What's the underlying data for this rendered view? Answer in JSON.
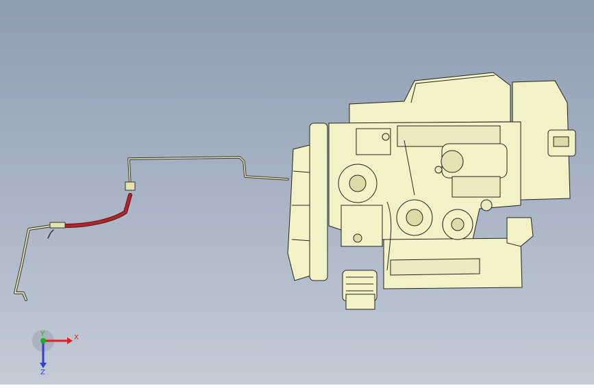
{
  "viewport": {
    "background_top": "#8d9db2",
    "background_bottom": "#c3cbd6",
    "part_color": "#f3f2c6",
    "line_color": "#222222",
    "hose_color": "#b0262a"
  },
  "triad": {
    "x_label": "X",
    "y_label": "Y",
    "z_label": "Z",
    "x_color": "#e02020",
    "y_color": "#1bb01b",
    "z_color": "#2c3fd6"
  }
}
